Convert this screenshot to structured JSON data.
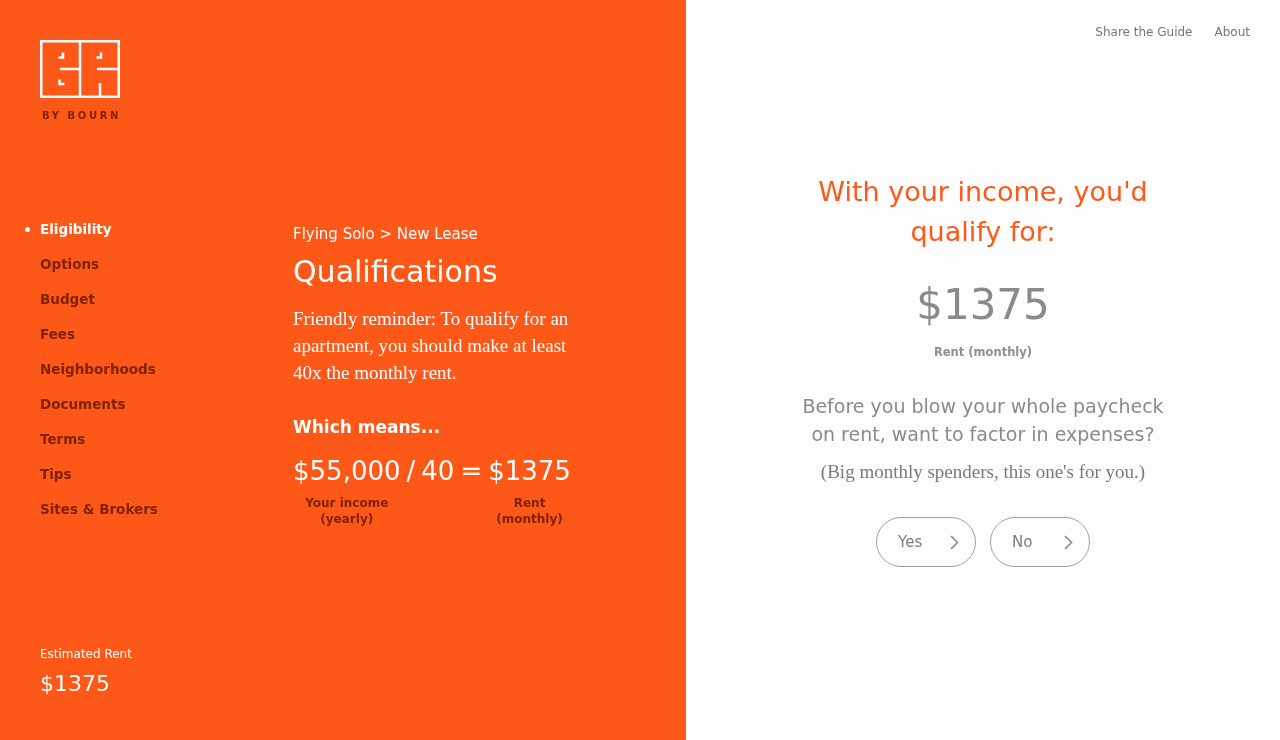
{
  "brand": {
    "tagline": "BY BOURN"
  },
  "nav": [
    {
      "label": "Eligibility",
      "selected": true
    },
    {
      "label": "Options",
      "selected": false
    },
    {
      "label": "Budget",
      "selected": false
    },
    {
      "label": "Fees",
      "selected": false
    },
    {
      "label": "Neighborhoods",
      "selected": false
    },
    {
      "label": "Documents",
      "selected": false
    },
    {
      "label": "Terms",
      "selected": false
    },
    {
      "label": "Tips",
      "selected": false
    },
    {
      "label": "Sites & Brokers",
      "selected": false
    }
  ],
  "estimate": {
    "label": "Estimated Rent",
    "value": "$1375"
  },
  "content": {
    "breadcrumb": "Flying Solo > New Lease",
    "title": "Qualifications",
    "reminder": "Friendly reminder: To qualify for an apartment, you should make at least 40x the monthly rent.",
    "subheading": "Which means...",
    "equation": [
      {
        "kind": "term",
        "text": "$55,000",
        "caption": "Your income (yearly)"
      },
      {
        "kind": "operator",
        "text": "/"
      },
      {
        "kind": "term",
        "text": "40"
      },
      {
        "kind": "operator",
        "text": "="
      },
      {
        "kind": "term",
        "text": "$1375",
        "caption": "Rent (monthly)"
      }
    ]
  },
  "top_links": [
    {
      "label": "Share the Guide"
    },
    {
      "label": "About"
    }
  ],
  "result": {
    "heading": "With your income, you'd qualify for:",
    "amount": "$1375",
    "caption": "Rent (monthly)",
    "question": "Before you blow your whole paycheck on rent, want to factor in expenses?",
    "note": "(Big monthly spenders, this one's for you.)",
    "buttons": [
      {
        "label": "Yes"
      },
      {
        "label": "No"
      }
    ]
  }
}
